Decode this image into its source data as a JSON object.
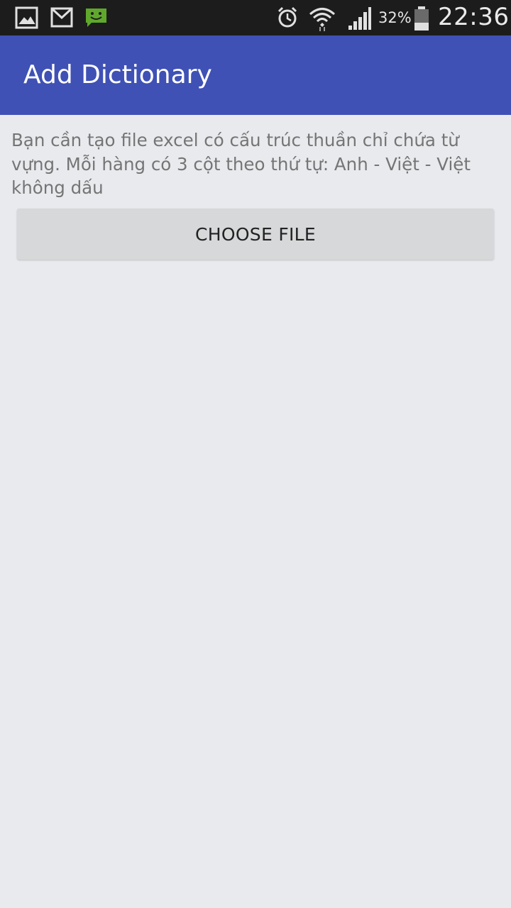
{
  "status_bar": {
    "battery_percent": "32%",
    "time": "22:36",
    "icons": [
      "gallery-notification-icon",
      "gmail-notification-icon",
      "message-notification-icon",
      "alarm-icon",
      "wifi-icon",
      "signal-icon",
      "battery-icon"
    ],
    "message_icon_color": "#5fa82c"
  },
  "app_bar": {
    "title": "Add Dictionary",
    "color": "#3f51b5"
  },
  "main": {
    "instruction": "Bạn cần tạo file excel có cấu trúc thuần chỉ chứa từ vựng. Mỗi hàng có 3 cột theo thứ tự: Anh - Việt - Việt không dấu",
    "choose_file_label": "CHOOSE FILE"
  }
}
